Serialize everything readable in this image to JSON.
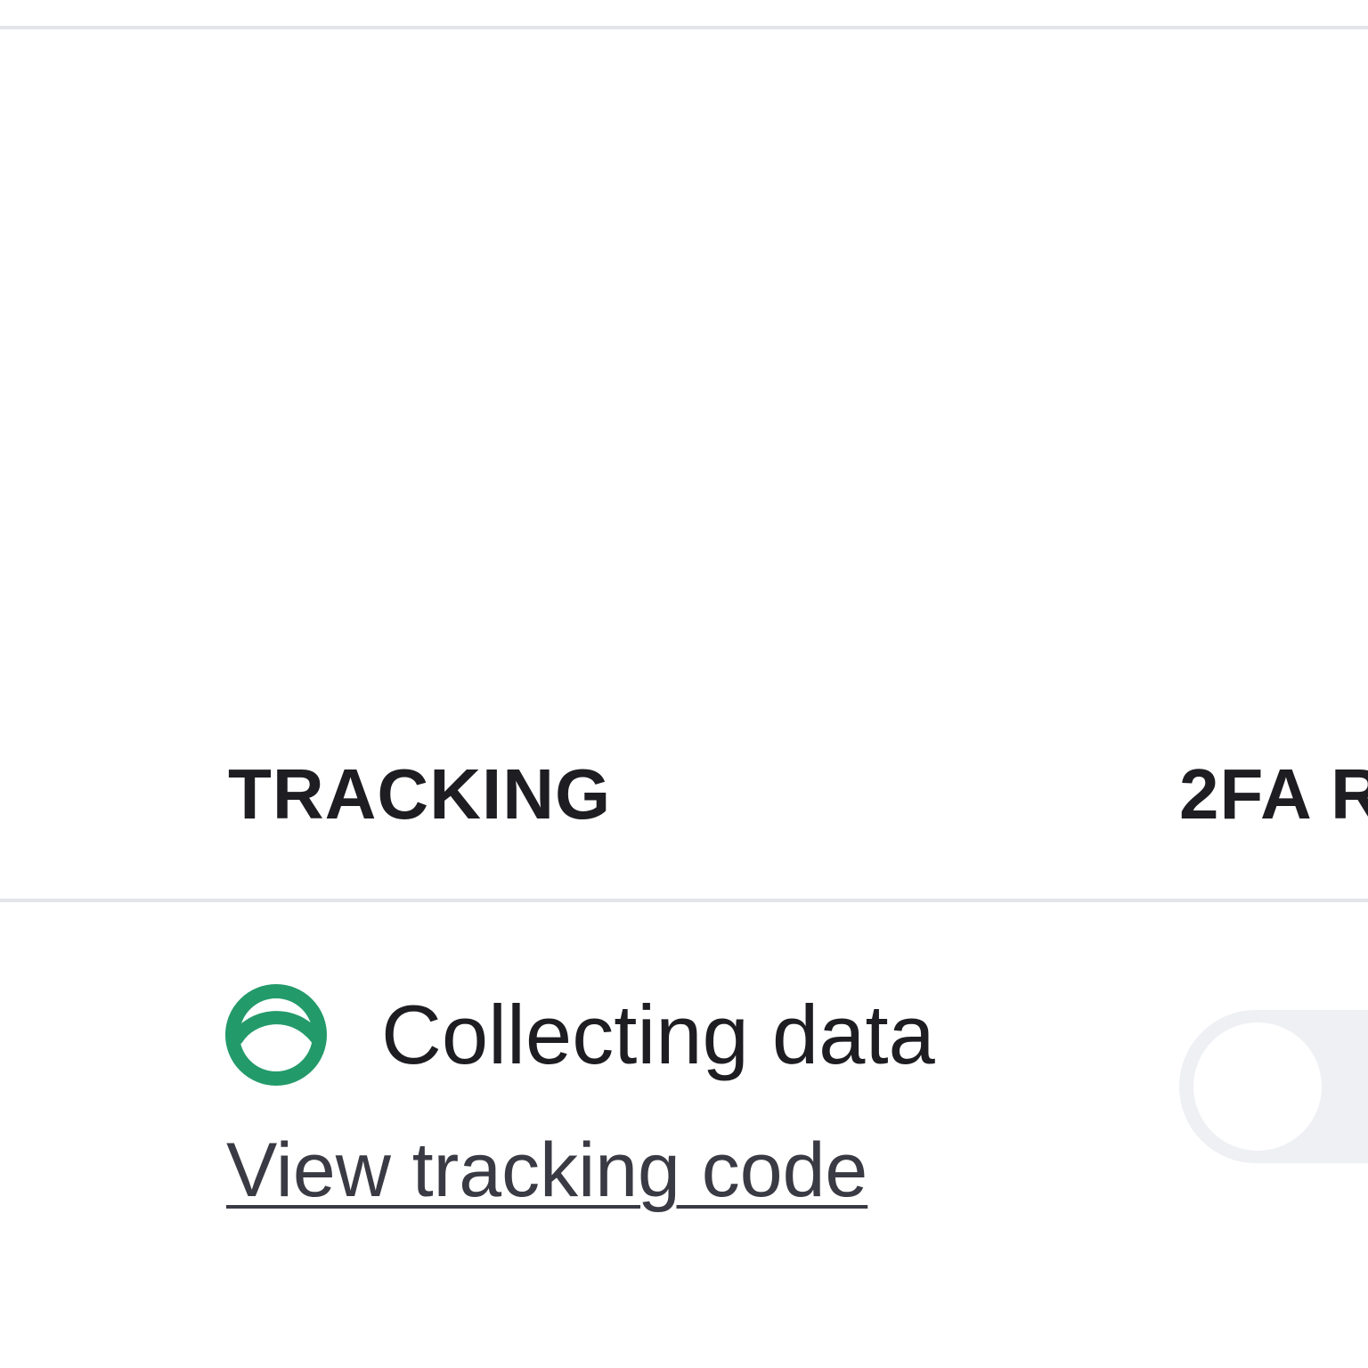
{
  "table": {
    "headers": {
      "tracking": "TRACKING",
      "twofa": "2FA R"
    },
    "rows": [
      {
        "tracking": {
          "status_icon": "status-collecting-icon",
          "status_text": "Collecting data",
          "status_color": "#239a6a",
          "link_text": "View tracking code"
        },
        "twofa_toggle": {
          "checked": false
        }
      }
    ]
  }
}
